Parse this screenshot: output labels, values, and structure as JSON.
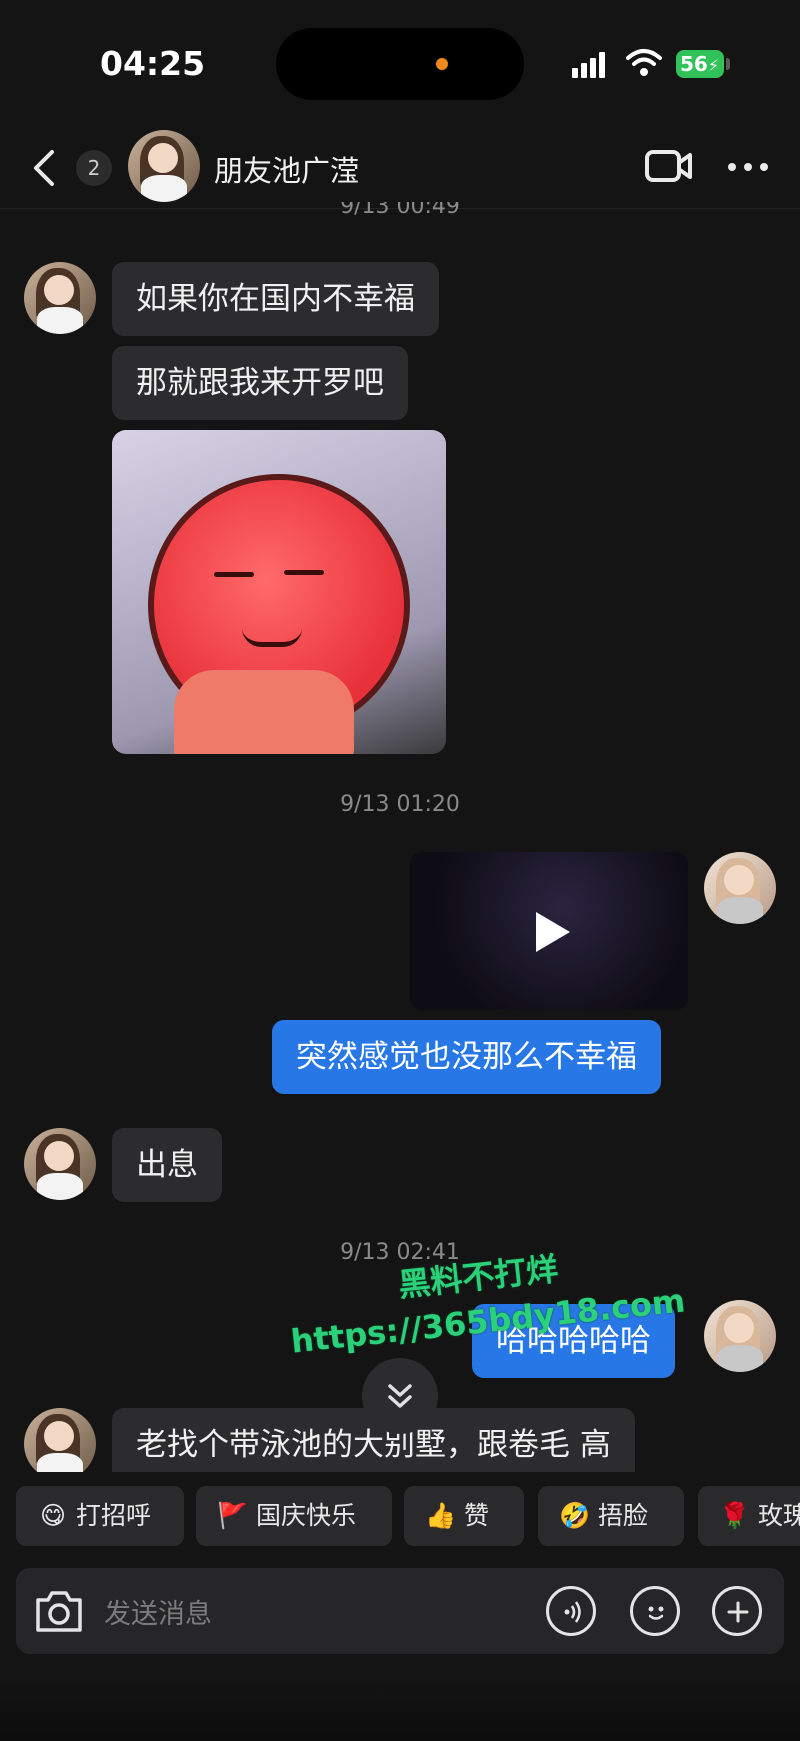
{
  "status_bar": {
    "time": "04:25",
    "battery": "56"
  },
  "header": {
    "unread_count": "2",
    "title": "朋友池广滢"
  },
  "messages": {
    "partial_timestamp": "9/13 00:49",
    "m1": "如果你在国内不幸福",
    "m2": "那就跟我来开罗吧",
    "ts2": "9/13 01:20",
    "m3": "突然感觉也没那么不幸福",
    "m4": "出息",
    "ts3": "9/13 02:41",
    "m5": "哈哈哈哈哈",
    "m6": "老找个带泳池的大别墅，跟卷毛 高"
  },
  "watermark": {
    "line1": "黑料不打烊",
    "line2": "https://365bdy18.com"
  },
  "quick_replies": [
    {
      "icon": "😋",
      "label": "打招呼"
    },
    {
      "icon": "🚩",
      "label": "国庆快乐"
    },
    {
      "icon": "👍",
      "label": "赞"
    },
    {
      "icon": "🤣",
      "label": "捂脸"
    },
    {
      "icon": "🌹",
      "label": "玫瑰"
    }
  ],
  "input": {
    "placeholder": "发送消息"
  },
  "colors": {
    "outgoing_bubble": "#2877e6",
    "incoming_bubble": "#2c2c2e",
    "background": "#141414"
  },
  "icons": [
    "back-icon",
    "video-call-icon",
    "more-icon",
    "camera-icon",
    "voice-icon",
    "emoji-icon",
    "plus-icon",
    "play-icon",
    "chevron-double-down-icon"
  ]
}
